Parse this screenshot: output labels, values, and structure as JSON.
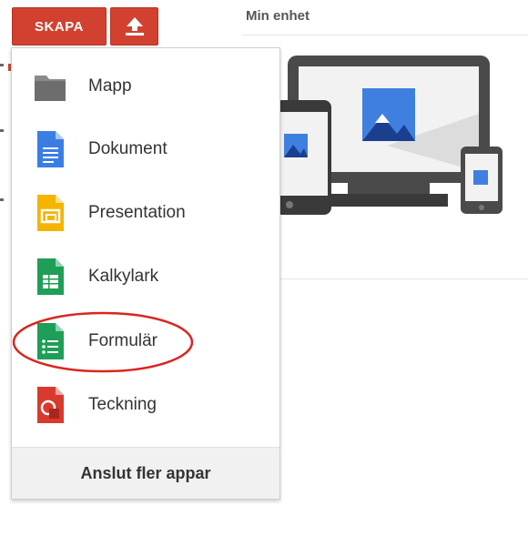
{
  "toolbar": {
    "create_label": "SKAPA",
    "upload_icon": "upload-icon"
  },
  "main": {
    "section_title": "Min enhet"
  },
  "menu": {
    "items": [
      {
        "label": "Mapp",
        "icon": "folder-icon"
      },
      {
        "label": "Dokument",
        "icon": "docs-icon"
      },
      {
        "label": "Presentation",
        "icon": "slides-icon"
      },
      {
        "label": "Kalkylark",
        "icon": "sheets-icon"
      },
      {
        "label": "Formulär",
        "icon": "forms-icon"
      },
      {
        "label": "Teckning",
        "icon": "drawings-icon"
      }
    ],
    "footer_label": "Anslut fler appar"
  },
  "colors": {
    "create_red": "#d2412f",
    "highlight_ring": "#d9251f"
  }
}
